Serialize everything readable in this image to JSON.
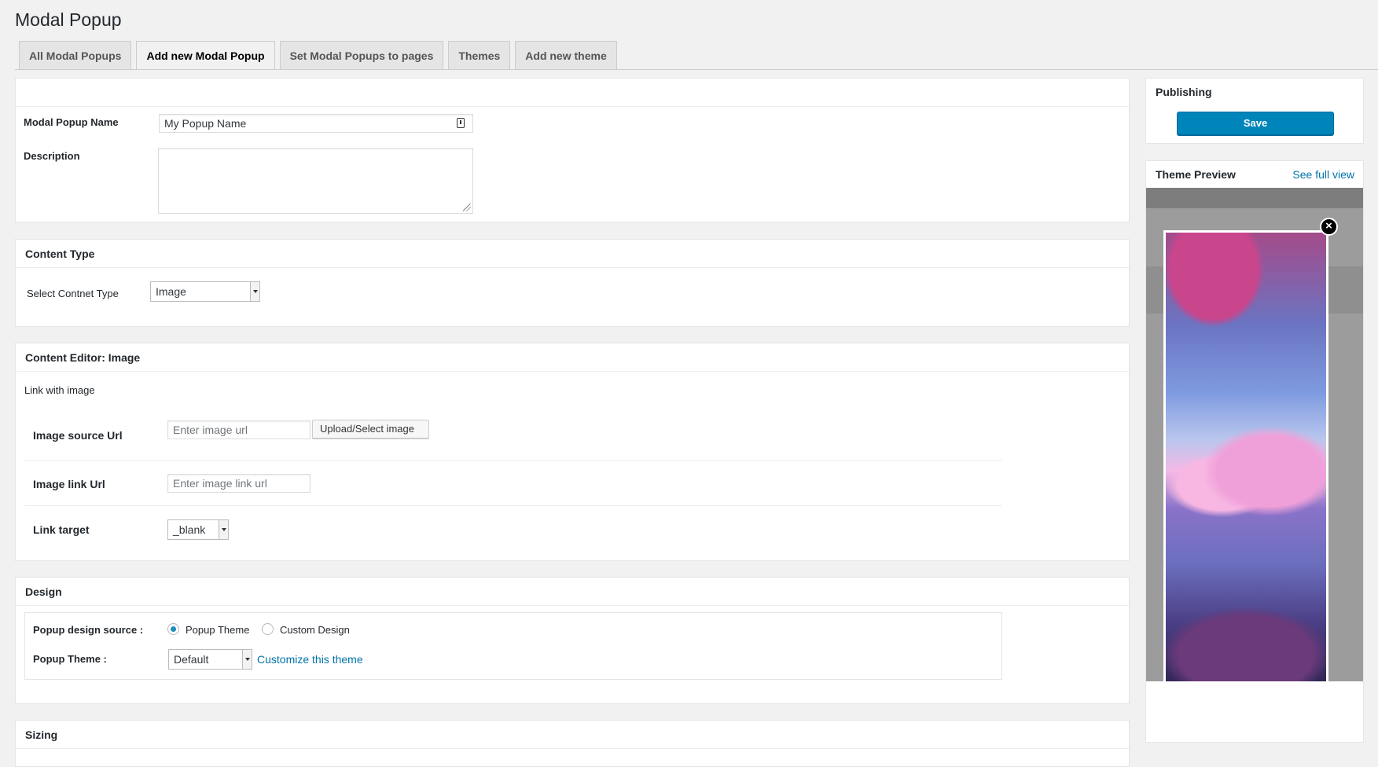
{
  "page": {
    "title": "Modal Popup"
  },
  "tabs": [
    {
      "label": "All Modal Popups"
    },
    {
      "label": "Add new Modal Popup"
    },
    {
      "label": "Set Modal Popups to pages"
    },
    {
      "label": "Themes"
    },
    {
      "label": "Add new theme"
    }
  ],
  "basic": {
    "name_label": "Modal Popup Name",
    "name_value": "My Popup Name",
    "description_label": "Description"
  },
  "content_type": {
    "title": "Content Type",
    "select_label": "Select Contnet Type",
    "selected": "Image"
  },
  "content_editor": {
    "title": "Content Editor: Image",
    "subtitle": "Link with image",
    "image_source_label": "Image source Url",
    "image_source_placeholder": "Enter image url",
    "upload_button": "Upload/Select image",
    "image_link_label": "Image link Url",
    "image_link_placeholder": "Enter image link url",
    "link_target_label": "Link target",
    "link_target_value": "_blank"
  },
  "design": {
    "title": "Design",
    "source_label": "Popup design source :",
    "option_theme": "Popup Theme",
    "option_custom": "Custom Design",
    "theme_label": "Popup Theme :",
    "theme_selected": "Default",
    "customize_link": "Customize this theme"
  },
  "sizing": {
    "title": "Sizing"
  },
  "publishing": {
    "title": "Publishing",
    "save_label": "Save"
  },
  "theme_preview": {
    "title": "Theme Preview",
    "see_full_view": "See full view",
    "close_glyph": "×"
  },
  "colors": {
    "primary": "#0085ba",
    "link": "#0073aa",
    "background": "#f1f1f1"
  }
}
